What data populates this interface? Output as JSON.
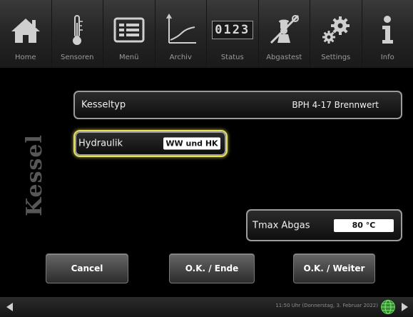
{
  "nav": {
    "items": [
      {
        "label": "Home",
        "icon": "house-icon"
      },
      {
        "label": "Sensoren",
        "icon": "thermometer-icon"
      },
      {
        "label": "Menü",
        "icon": "menu-list-icon"
      },
      {
        "label": "Archiv",
        "icon": "line-chart-icon"
      },
      {
        "label": "Status",
        "icon": "counter-icon"
      },
      {
        "label": "Abgastest",
        "icon": "chimney-sweep-icon"
      },
      {
        "label": "Settings",
        "icon": "gears-icon"
      },
      {
        "label": "Info",
        "icon": "info-icon"
      }
    ],
    "status_counter": "0123"
  },
  "page": {
    "side_title": "Kessel"
  },
  "fields": {
    "kesseltyp": {
      "label": "Kesseltyp",
      "value": "BPH 4-17 Brennwert"
    },
    "hydraulik": {
      "label": "Hydraulik",
      "value": "WW und HK"
    },
    "tmax_abgas": {
      "label": "Tmax Abgas",
      "value": "80 °C"
    }
  },
  "buttons": {
    "cancel": "Cancel",
    "ok_ende": "O.K. / Ende",
    "ok_weiter": "O.K. / Weiter"
  },
  "statusbar": {
    "datetime": "11:50 Uhr (Donnerstag, 3. Februar 2022)"
  },
  "colors": {
    "highlight": "#e6e25a",
    "globe_green": "#3da534",
    "background": "#000000"
  }
}
